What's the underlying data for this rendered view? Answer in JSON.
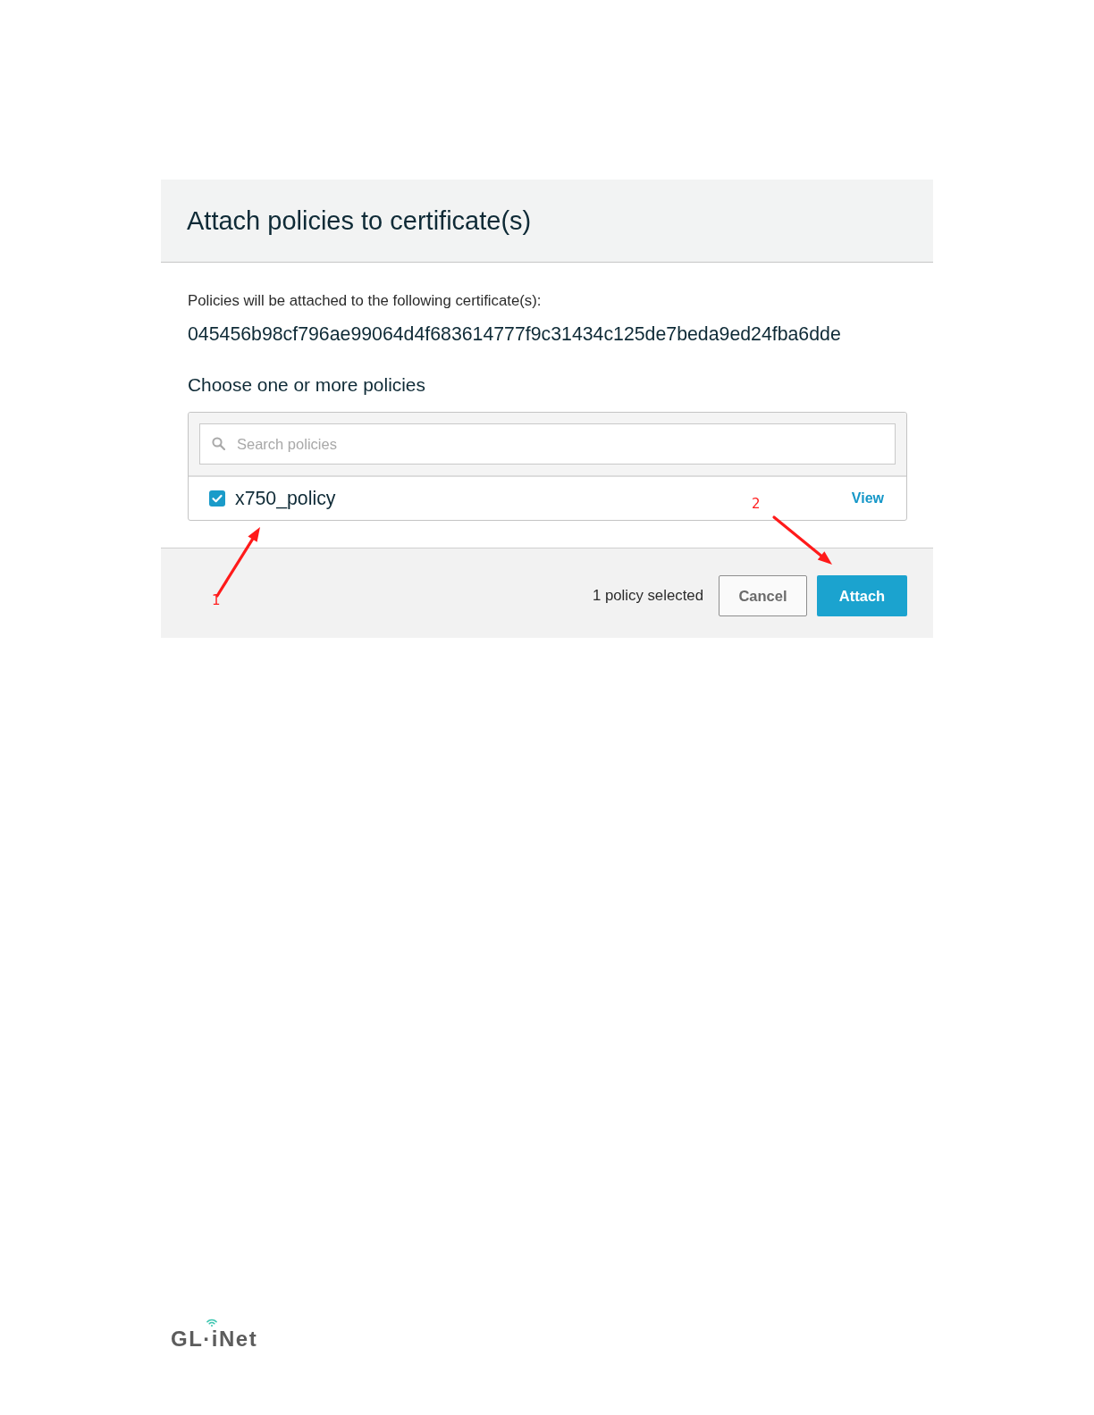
{
  "dialog": {
    "title": "Attach policies to certificate(s)",
    "description": "Policies will be attached to the following certificate(s):",
    "certificate_id": "045456b98cf796ae99064d4f683614777f9c31434c125de7beda9ed24fba6dde",
    "section_heading": "Choose one or more policies",
    "search": {
      "placeholder": "Search policies"
    },
    "policies": [
      {
        "name": "x750_policy",
        "checked": true,
        "link": "View"
      }
    ],
    "footer": {
      "selection_count": "1 policy selected",
      "buttons": [
        {
          "label": "Cancel",
          "kind": "secondary"
        },
        {
          "label": "Attach",
          "kind": "primary"
        }
      ]
    }
  },
  "annotations": [
    {
      "label": "1"
    },
    {
      "label": "2"
    }
  ],
  "footer_logo": {
    "text": "GL·iNet"
  }
}
